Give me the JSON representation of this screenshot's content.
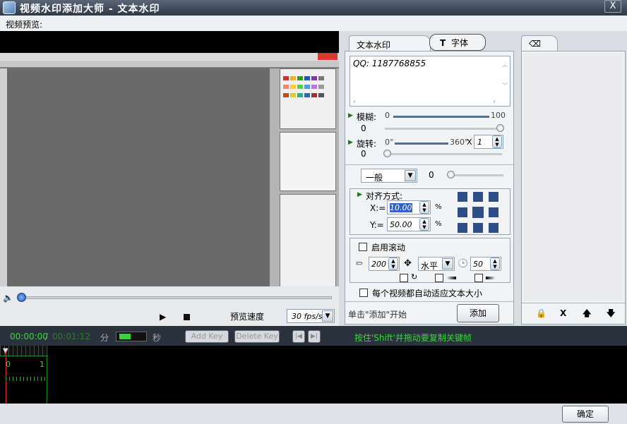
{
  "window": {
    "title": "视频水印添加大师 - 文本水印",
    "close_label": "X"
  },
  "preview_caption": "视频预览:",
  "player": {
    "speed_label": "预览速度",
    "fps_value": "30 fps/s",
    "play_glyph": "▶",
    "volume_glyph": "🔈"
  },
  "text_panel": {
    "tab_text": "文本水印",
    "tab_font": "字体",
    "tab_font_glyph": "T",
    "text_value": "QQ:  1187768855",
    "blur": {
      "label": "模糊:",
      "min": "0",
      "max": "100",
      "value": "0",
      "level": 0
    },
    "rotate": {
      "label": "旋转:",
      "min": "0°",
      "max": "360°",
      "step": "1",
      "value": "0",
      "level": 0
    },
    "blend": {
      "mode": "一般",
      "value": "0",
      "level": 0
    },
    "align": {
      "label": "对齐方式:",
      "x_label": "X:=",
      "x_value": "10.00",
      "y_label": "Y:=",
      "y_value": "50.00",
      "unit": "%"
    },
    "scroll": {
      "label": "启用滚动",
      "speed": "200",
      "direction": "水平",
      "delay": "50"
    },
    "auto_fit_label": "每个视频都自动适应文本大小",
    "hint": "单击\"添加\"开始",
    "add_button": "添加"
  },
  "list_panel": {
    "tab_icon": "eraser-icon",
    "lock_label": "🔒",
    "delete_label": "X",
    "up_label": "🡅",
    "down_label": "🡇"
  },
  "timeline": {
    "time_current": "00:00:00",
    "time_sep": "/",
    "time_total": "00:01:12",
    "min_label": "分",
    "sec_label": "秒",
    "add_key": "Add Key",
    "delete_key": "Delete Key",
    "hint": "按住'Shift'并拖动要复制关键帧",
    "ruler_0": "0",
    "ruler_1": "1"
  },
  "ok_button": "确定",
  "colors": {
    "accent_green": "#37d637",
    "title_bg": "#2e3846",
    "panel_bg": "#f2f3f5"
  }
}
